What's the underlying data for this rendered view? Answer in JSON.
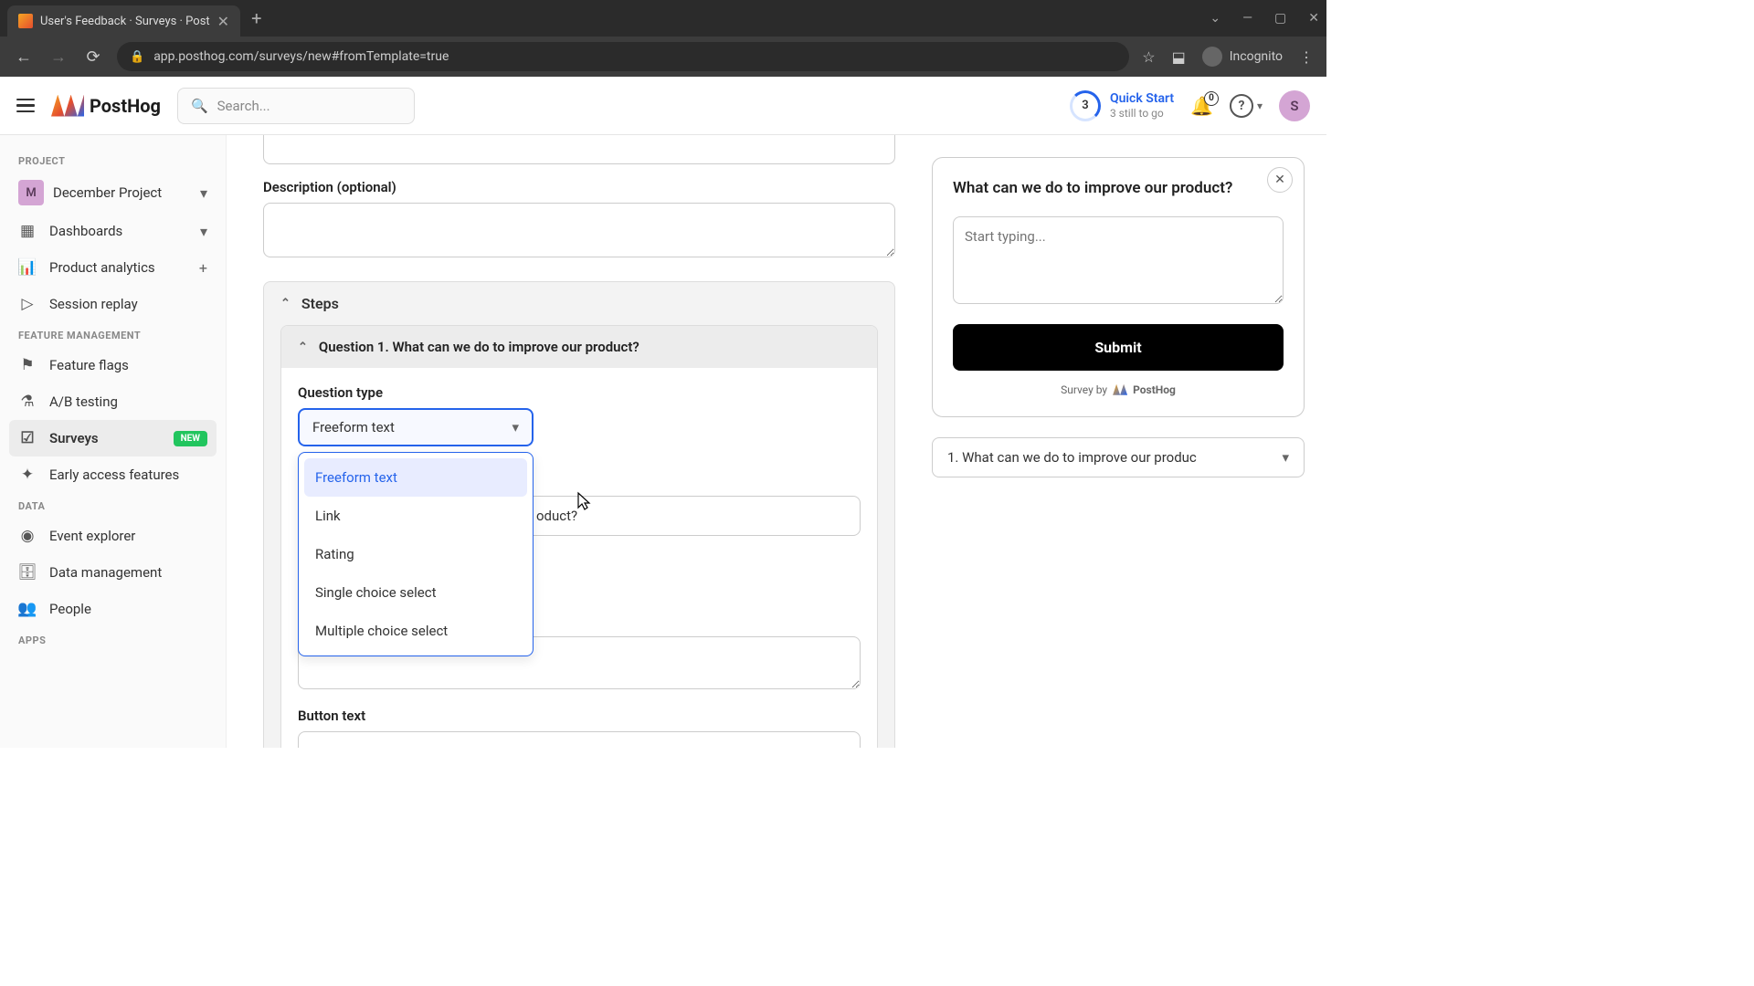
{
  "browser": {
    "tab_title": "User's Feedback · Surveys · Post",
    "url": "app.posthog.com/surveys/new#fromTemplate=true",
    "incognito_label": "Incognito"
  },
  "header": {
    "brand": "PostHog",
    "search_placeholder": "Search...",
    "progress_count": "3",
    "quick_start_label": "Quick Start",
    "quick_start_sub": "3 still to go",
    "notif_count": "0",
    "avatar_letter": "S"
  },
  "sidebar": {
    "section_project": "PROJECT",
    "project_name": "December Project",
    "project_letter": "M",
    "items": {
      "dashboards": "Dashboards",
      "product_analytics": "Product analytics",
      "session_replay": "Session replay"
    },
    "section_feature": "FEATURE MANAGEMENT",
    "feature_items": {
      "feature_flags": "Feature flags",
      "ab_testing": "A/B testing",
      "surveys": "Surveys",
      "surveys_badge": "NEW",
      "early_access": "Early access features"
    },
    "section_data": "DATA",
    "data_items": {
      "event_explorer": "Event explorer",
      "data_management": "Data management",
      "people": "People"
    },
    "section_apps": "APPS"
  },
  "form": {
    "desc_label": "Description (optional)",
    "steps_label": "Steps",
    "question_header": "Question 1. What can we do to improve our product?",
    "question_type_label": "Question type",
    "question_type_selected": "Freeform text",
    "question_type_options": [
      "Freeform text",
      "Link",
      "Rating",
      "Single choice select",
      "Multiple choice select"
    ],
    "behind_text": "oduct?",
    "button_text_label": "Button text"
  },
  "preview": {
    "question": "What can we do to improve our product?",
    "placeholder": "Start typing...",
    "submit": "Submit",
    "survey_by": "Survey by",
    "brand": "PostHog",
    "q_nav": "1. What can we do to improve our produc"
  }
}
